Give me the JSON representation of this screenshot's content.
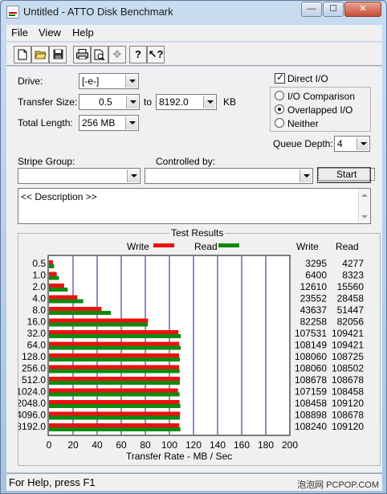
{
  "window": {
    "title": "Untitled - ATTO Disk Benchmark"
  },
  "menu": [
    "File",
    "View",
    "Help"
  ],
  "toolbar": [
    "new-icon",
    "open-icon",
    "save-icon",
    "print-icon",
    "print-preview-icon",
    "move-icon",
    "help-icon",
    "context-help-icon"
  ],
  "form": {
    "drive_label": "Drive:",
    "drive_value": "[-e-]",
    "transfer_size_label": "Transfer Size:",
    "transfer_from": "0.5",
    "to_label": "to",
    "transfer_to": "8192.0",
    "kb_label": "KB",
    "total_length_label": "Total Length:",
    "total_length_value": "256 MB",
    "direct_io_label": "Direct I/O",
    "direct_io_checked": true,
    "io_options": [
      "I/O Comparison",
      "Overlapped I/O",
      "Neither"
    ],
    "io_selected": "Overlapped I/O",
    "queue_depth_label": "Queue Depth:",
    "queue_depth_value": "4",
    "stripe_group_label": "Stripe Group:",
    "stripe_group_value": "",
    "controlled_by_label": "Controlled by:",
    "controlled_by_value": "",
    "start_label": "Start",
    "description": "<< Description >>"
  },
  "results": {
    "title": "Test Results",
    "write_legend": "Write",
    "read_legend": "Read",
    "write_col": "Write",
    "read_col": "Read",
    "xlabel": "Transfer Rate - MB / Sec",
    "colors": {
      "write": "#ee1111",
      "read": "#0f8a0f",
      "grid": "#1a1a9a"
    }
  },
  "chart_data": {
    "type": "bar",
    "categories": [
      "0.5",
      "1.0",
      "2.0",
      "4.0",
      "8.0",
      "16.0",
      "32.0",
      "64.0",
      "128.0",
      "256.0",
      "512.0",
      "1024.0",
      "2048.0",
      "4096.0",
      "8192.0"
    ],
    "series": [
      {
        "name": "Write",
        "values": [
          3295,
          6400,
          12610,
          23552,
          43637,
          82258,
          107531,
          108149,
          108060,
          108060,
          108678,
          107159,
          108458,
          108898,
          108240
        ]
      },
      {
        "name": "Read",
        "values": [
          4277,
          8323,
          15560,
          28458,
          51447,
          82056,
          109421,
          109421,
          108725,
          108502,
          108678,
          108458,
          109120,
          108678,
          109120
        ]
      }
    ],
    "xticks": [
      "0",
      "20",
      "40",
      "60",
      "80",
      "100",
      "120",
      "140",
      "160",
      "180",
      "200"
    ],
    "xlim": [
      0,
      200
    ],
    "xlabel": "Transfer Rate - MB / Sec"
  },
  "statusbar": {
    "text": "For Help, press F1",
    "watermark": "泡泡网 PCPOP.COM"
  }
}
